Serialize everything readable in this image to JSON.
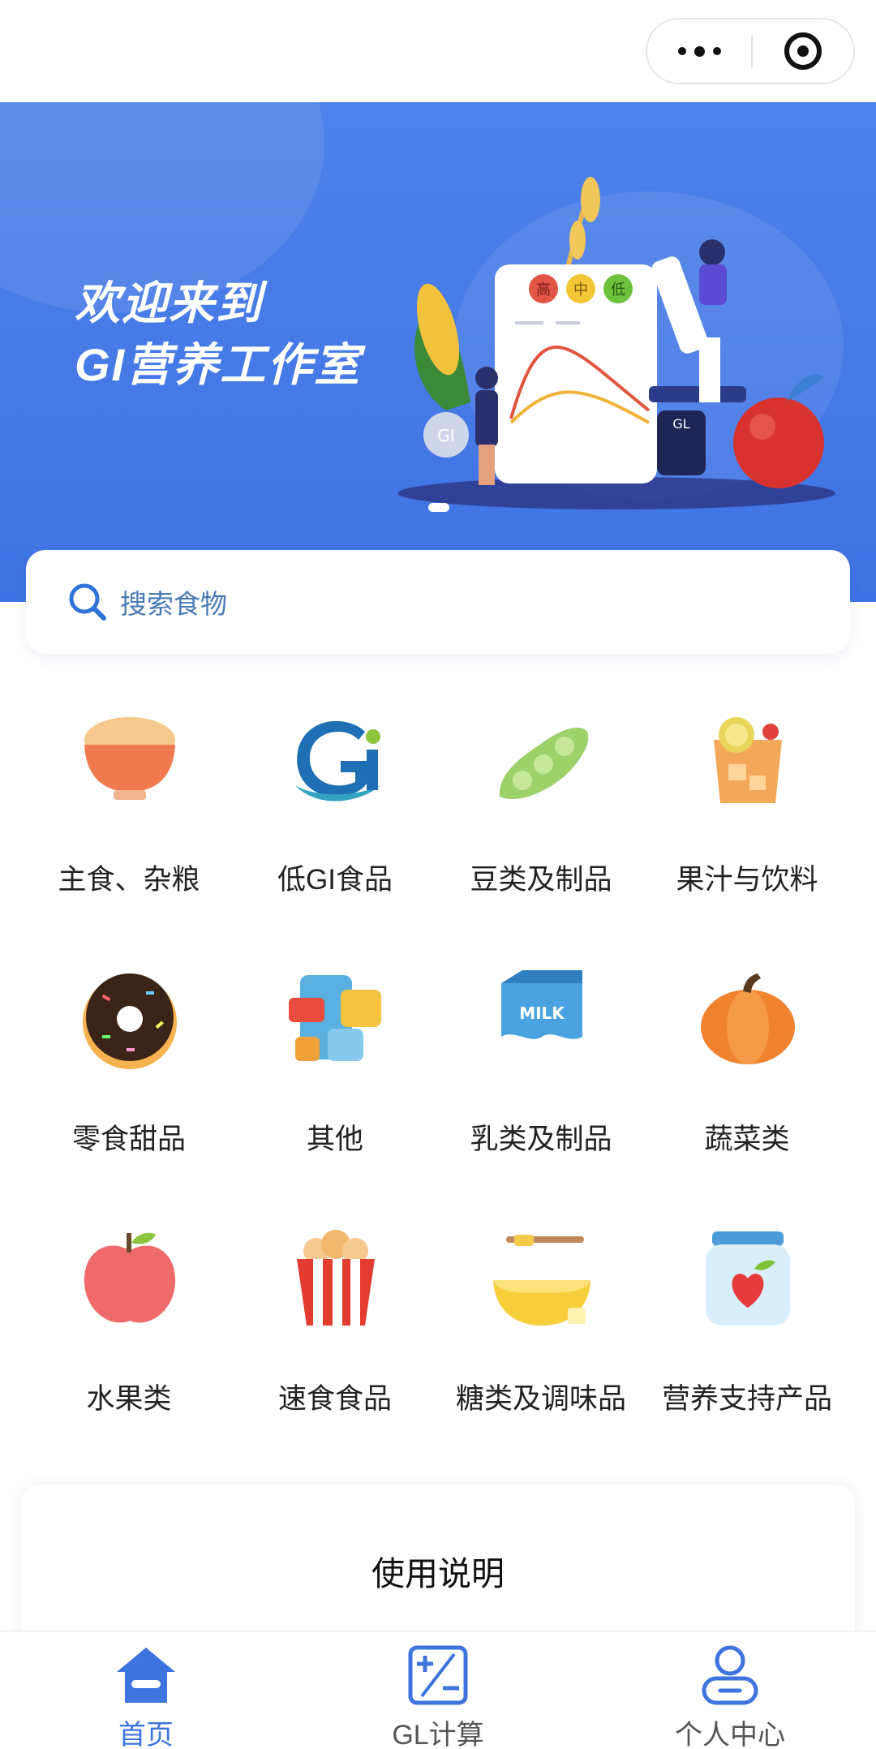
{
  "capsule": {
    "more_icon": "more-dots-icon",
    "close_icon": "target-close-icon"
  },
  "banner": {
    "title_line1": "欢迎来到",
    "title_line2": "GI营养工作室",
    "board_labels": [
      "高",
      "中",
      "低"
    ],
    "gi_badge": "GI",
    "gl_badge": "GL",
    "slide_count": 1,
    "current_slide": 1
  },
  "search": {
    "placeholder": "搜索食物",
    "icon": "search-icon"
  },
  "categories": [
    {
      "label": "主食、杂粮",
      "icon": "rice-bowl-icon"
    },
    {
      "label": "低GI食品",
      "icon": "gi-logo-icon"
    },
    {
      "label": "豆类及制品",
      "icon": "soybean-icon"
    },
    {
      "label": "果汁与饮料",
      "icon": "juice-drink-icon"
    },
    {
      "label": "零食甜品",
      "icon": "donut-icon"
    },
    {
      "label": "其他",
      "icon": "misc-food-icon"
    },
    {
      "label": "乳类及制品",
      "icon": "milk-carton-icon"
    },
    {
      "label": "蔬菜类",
      "icon": "pumpkin-icon"
    },
    {
      "label": "水果类",
      "icon": "apple-icon"
    },
    {
      "label": "速食食品",
      "icon": "popcorn-icon"
    },
    {
      "label": "糖类及调味品",
      "icon": "honey-icon"
    },
    {
      "label": "营养支持产品",
      "icon": "nutrition-jar-icon"
    }
  ],
  "milk_text": "MILK",
  "instructions": {
    "title": "使用说明"
  },
  "tabbar": {
    "tabs": [
      {
        "label": "首页",
        "icon": "home-icon",
        "active": true
      },
      {
        "label": "GL计算",
        "icon": "calculator-icon",
        "active": false
      },
      {
        "label": "个人中心",
        "icon": "user-icon",
        "active": false
      }
    ]
  },
  "colors": {
    "accent": "#3d74de",
    "banner": "#4579e6",
    "search_text": "#4a7bb5"
  }
}
